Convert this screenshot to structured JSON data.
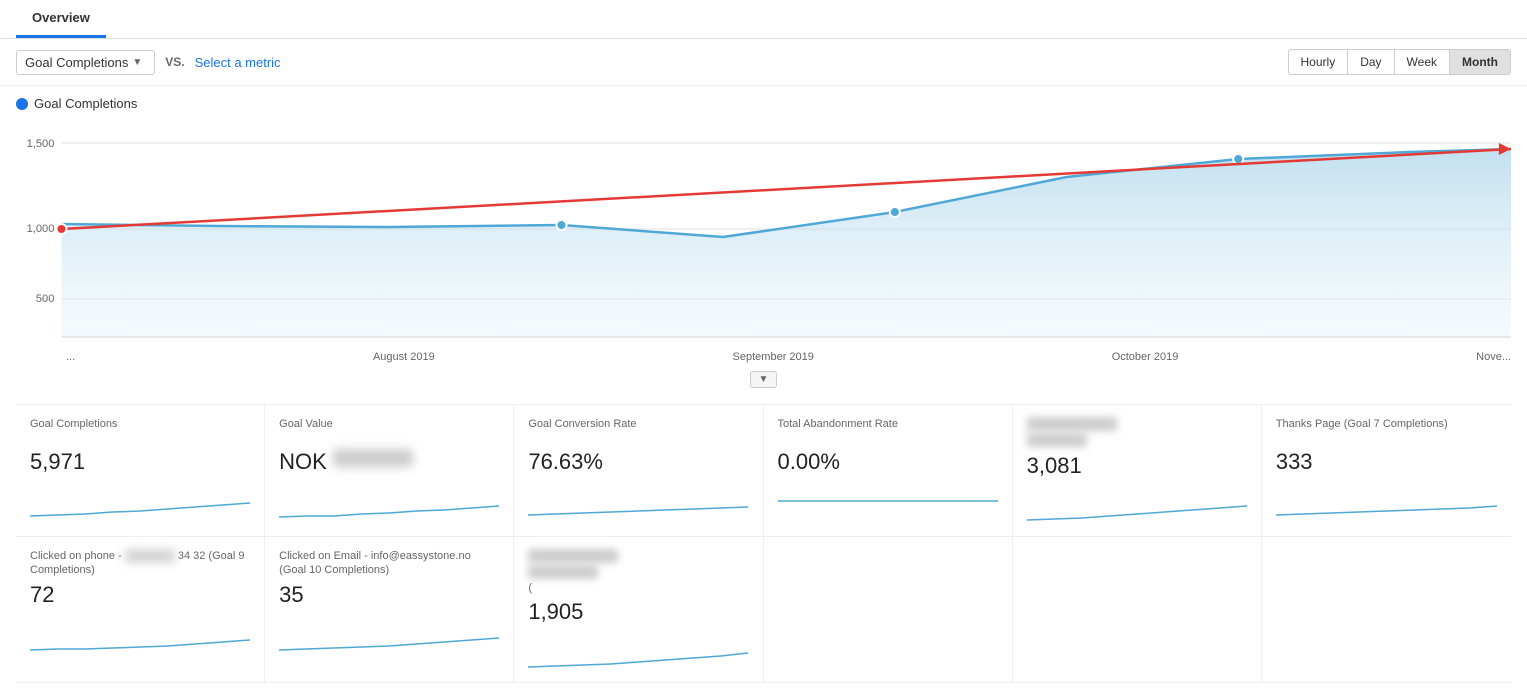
{
  "tab": {
    "label": "Overview"
  },
  "toolbar": {
    "metric_label": "Goal Completions",
    "vs_label": "VS.",
    "select_metric": "Select a metric",
    "time_buttons": [
      {
        "label": "Hourly",
        "active": false
      },
      {
        "label": "Day",
        "active": false
      },
      {
        "label": "Week",
        "active": false
      },
      {
        "label": "Month",
        "active": true
      }
    ]
  },
  "chart": {
    "legend_label": "Goal Completions",
    "y_labels": [
      "1,500",
      "500"
    ],
    "y_1000": "1,000",
    "x_labels": [
      "...",
      "August 2019",
      "September 2019",
      "October 2019",
      "Nove..."
    ]
  },
  "metrics_row1": [
    {
      "title": "Goal Completions",
      "value": "5,971"
    },
    {
      "title": "Goal Value",
      "value": "NOK",
      "blurred_val": true
    },
    {
      "title": "Goal Conversion Rate",
      "value": "76.63%"
    },
    {
      "title": "Total Abandonment Rate",
      "value": "0.00%"
    },
    {
      "title": "",
      "blurred_title": true,
      "value": "3,081"
    },
    {
      "title": "Thanks Page (Goal 7 Completions)",
      "value": "333"
    }
  ],
  "metrics_row2": [
    {
      "title": "Clicked on phone - [blurred] 34 32 (Goal 9 Completions)",
      "value": "72",
      "blurred_title": false
    },
    {
      "title": "Clicked on Email - info@eassystone.no (Goal 10 Completions)",
      "value": "35"
    },
    {
      "title": "",
      "blurred_title": true,
      "value": "1,905"
    },
    {
      "empty": true
    },
    {
      "empty": true
    },
    {
      "empty": true
    }
  ],
  "colors": {
    "blue": "#1a73e8",
    "chart_blue": "#4fa8d5",
    "chart_area": "#e8f4f8",
    "red": "#e53935"
  }
}
